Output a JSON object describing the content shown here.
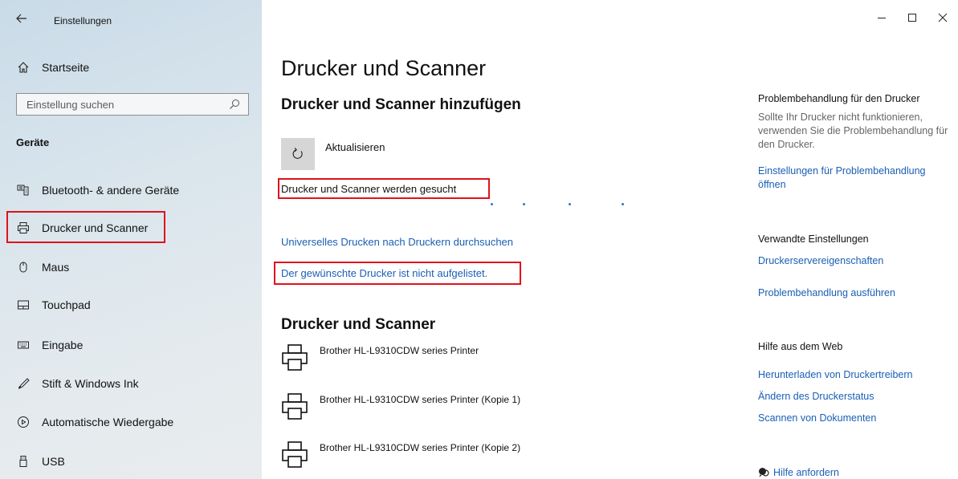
{
  "window": {
    "title": "Einstellungen",
    "back_icon": "arrow-left-icon",
    "controls": [
      "minimize-icon",
      "maximize-icon",
      "close-icon"
    ]
  },
  "sidebar": {
    "home_label": "Startseite",
    "search_placeholder": "Einstellung suchen",
    "section_label": "Geräte",
    "items": [
      {
        "label": "Bluetooth- & andere Geräte",
        "icon": "bluetooth-devices-icon"
      },
      {
        "label": "Drucker und Scanner",
        "icon": "printer-icon",
        "selected": true
      },
      {
        "label": "Maus",
        "icon": "mouse-icon"
      },
      {
        "label": "Touchpad",
        "icon": "touchpad-icon"
      },
      {
        "label": "Eingabe",
        "icon": "keyboard-icon"
      },
      {
        "label": "Stift & Windows Ink",
        "icon": "pen-icon"
      },
      {
        "label": "Automatische Wiedergabe",
        "icon": "autoplay-icon"
      },
      {
        "label": "USB",
        "icon": "usb-icon"
      }
    ]
  },
  "main": {
    "title": "Drucker und Scanner",
    "add_section_title": "Drucker und Scanner hinzufügen",
    "refresh_label": "Aktualisieren",
    "searching_text": "Drucker und Scanner werden gesucht",
    "link_universal_print": "Universelles Drucken nach Druckern durchsuchen",
    "link_not_listed": "Der gewünschte Drucker ist nicht aufgelistet.",
    "printers_heading": "Drucker und Scanner",
    "printers": [
      {
        "name": "Brother HL-L9310CDW series Printer"
      },
      {
        "name": "Brother HL-L9310CDW series Printer (Kopie 1)"
      },
      {
        "name": "Brother HL-L9310CDW series Printer (Kopie 2)"
      }
    ]
  },
  "right": {
    "troubleshoot_heading": "Problembehandlung für den Drucker",
    "troubleshoot_text": "Sollte Ihr Drucker nicht funktionieren, verwenden Sie die Problembehandlung für den Drucker.",
    "troubleshoot_link": "Einstellungen für Problembehandlung öffnen",
    "related_heading": "Verwandte Einstellungen",
    "related_links": [
      "Druckerservereigenschaften",
      "Problembehandlung ausführen"
    ],
    "help_heading": "Hilfe aus dem Web",
    "help_links": [
      "Herunterladen von Druckertreibern",
      "Ändern des Druckerstatus",
      "Scannen von Dokumenten"
    ],
    "get_help_label": "Hilfe anfordern"
  },
  "colors": {
    "accent_link": "#1a5fb4",
    "highlight_box": "#e0121b"
  }
}
